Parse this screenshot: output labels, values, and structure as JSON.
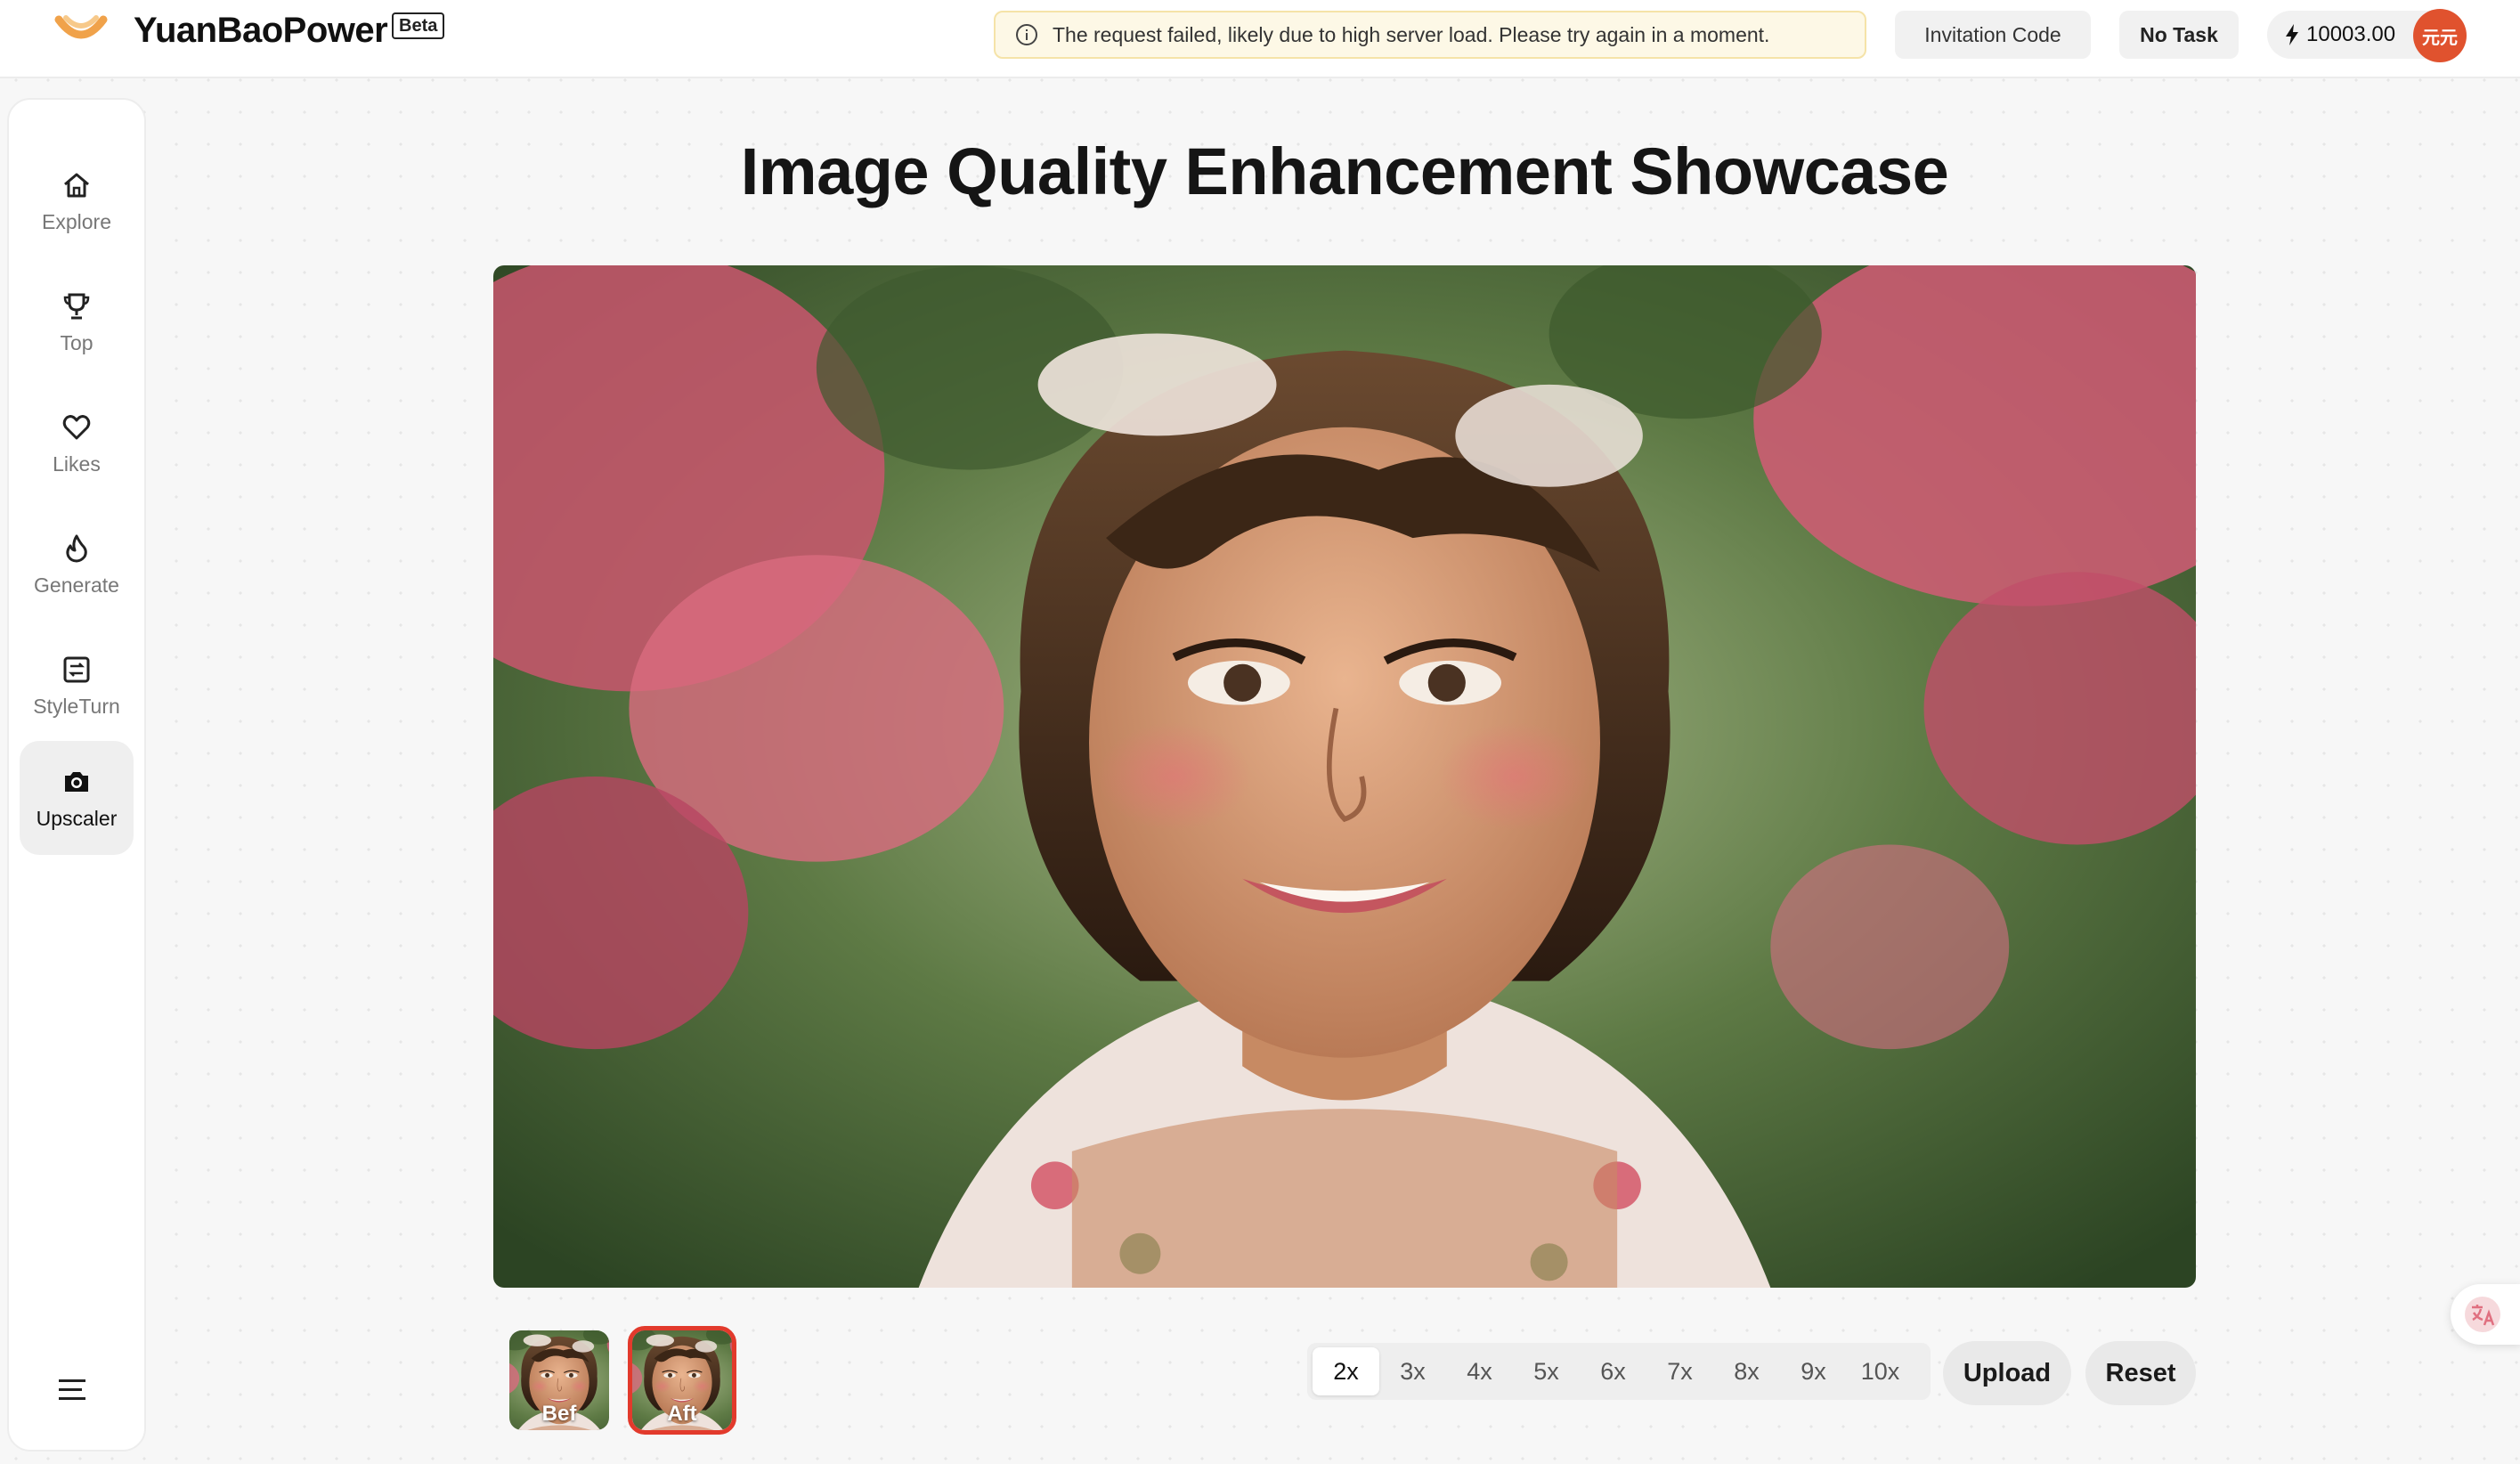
{
  "header": {
    "brand_name": "YuanBaoPower",
    "beta_label": "Beta",
    "alert_message": "The request failed, likely due to high server load. Please try again in a moment.",
    "invitation_label": "Invitation Code",
    "task_label": "No Task",
    "credits": "10003.00",
    "avatar_text": "元元"
  },
  "sidebar": {
    "items": [
      {
        "label": "Explore",
        "icon": "home-icon"
      },
      {
        "label": "Top",
        "icon": "trophy-icon"
      },
      {
        "label": "Likes",
        "icon": "heart-icon"
      },
      {
        "label": "Generate",
        "icon": "flame-icon"
      },
      {
        "label": "StyleTurn",
        "icon": "swap-icon"
      },
      {
        "label": "Upscaler",
        "icon": "camera-icon",
        "active": true
      }
    ],
    "menu_icon": "menu-icon"
  },
  "main": {
    "title": "Image Quality Enhancement Showcase",
    "showcase_image": "portrait of smiling woman with short hair among pink flowers",
    "thumbnails": [
      {
        "label": "Bef",
        "selected": false
      },
      {
        "label": "Aft",
        "selected": true
      }
    ],
    "scale_options": [
      "2x",
      "3x",
      "4x",
      "5x",
      "6x",
      "7x",
      "8x",
      "9x",
      "10x"
    ],
    "selected_scale": "2x",
    "upload_label": "Upload",
    "reset_label": "Reset"
  },
  "colors": {
    "accent_red": "#e23a2c",
    "alert_bg": "#fdf8e6",
    "logo_orange": "#f0a24a",
    "avatar_bg": "#e0522e"
  },
  "floating": {
    "translate_icon": "translate-icon"
  }
}
